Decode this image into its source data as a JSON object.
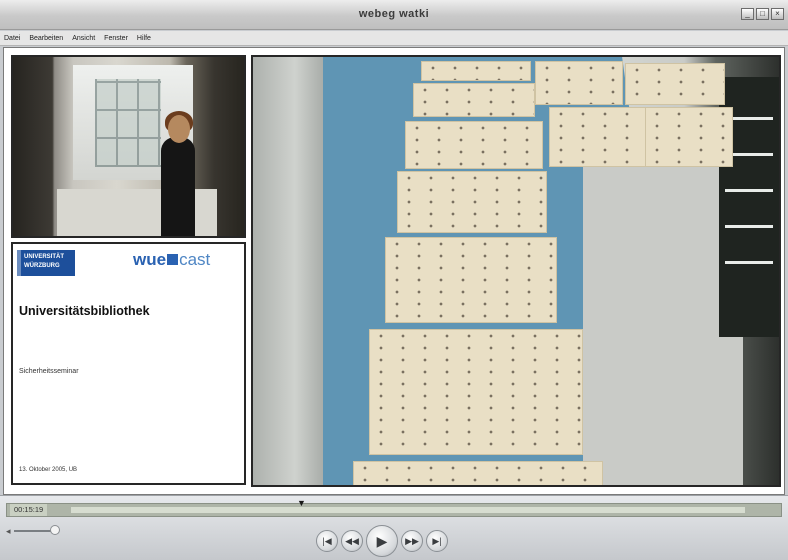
{
  "window": {
    "title": "webeg watki"
  },
  "menu": {
    "items": [
      "Datei",
      "Bearbeiten",
      "Ansicht",
      "Fenster",
      "Hilfe"
    ]
  },
  "slide": {
    "logo_text": "UNIVERSITÄT\nWÜRZBURG",
    "brand_left": "wue",
    "brand_right": "cast",
    "title": "Universitätsbibliothek",
    "subtitle": "Sicherheitsseminar",
    "date": "13. Oktober 2005, UB"
  },
  "player": {
    "timecode": "00:15:19",
    "progress": 0.35,
    "volume": 0.9
  },
  "icons": {
    "prev": "skip-back-icon",
    "rewind": "rewind-icon",
    "play": "play-icon",
    "forward": "fast-forward-icon",
    "next": "skip-forward-icon",
    "speaker": "speaker-icon"
  },
  "colors": {
    "brand_blue": "#2a62b2",
    "floor_blue": "#5f95b4"
  }
}
